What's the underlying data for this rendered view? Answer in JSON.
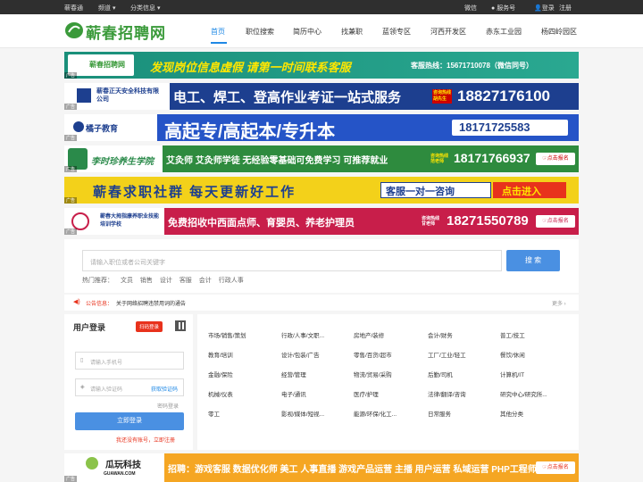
{
  "topbar": {
    "site": "蕲春通",
    "channel": "频道",
    "category": "分类信息",
    "wechat": "微信",
    "service": "服务号",
    "login": "登录",
    "register": "注册"
  },
  "header": {
    "logo_text": "蕲春招聘网",
    "nav": [
      "首页",
      "职位搜索",
      "简历中心",
      "找兼职",
      "蓝领专区",
      "河西开发区",
      "赤东工业园",
      "杨四岭园区"
    ]
  },
  "banners": {
    "b1": {
      "logo": "蕲春招聘网",
      "slogan": "发现岗位信息虚假  请第一时间联系客服",
      "hotline": "客服热线：15671710078（微信同号）"
    },
    "b2": {
      "company": "蕲春正天安全科技有限公司",
      "slogan": "电工、焊工、登高作业考证一站式服务",
      "contact": "咨询热线 胡先生",
      "phone": "18827176100"
    },
    "b3": {
      "company": "橘子教育",
      "slogan": "高起专/高起本/专升本",
      "phone": "18171725583"
    },
    "b4": {
      "company": "李时珍养生学院",
      "slogan": "艾灸师 艾灸师学徒 无经验零基础可免费学习 可推荐就业",
      "contact": "咨询热线 范老师",
      "phone": "18171766937",
      "btn": "点击报名"
    },
    "b5": {
      "slogan": "蕲春求职社群  每天更新好工作",
      "consult": "客服一对一咨询",
      "btn": "点击进入"
    },
    "b6": {
      "company": "蕲春大拇指康养职业技能培训学校",
      "slogan": "免费招收中西面点师、育婴员、养老护理员",
      "contact": "咨询热线 甘老师",
      "phone": "18271550789",
      "btn": "点击报名"
    },
    "b7": {
      "company": "瓜玩科技",
      "domain": "GUAWAN.COM",
      "slogan": "招聘：游戏客服 数据优化师 美工 人事直播 游戏产品运营 主播 用户运营 私域运营 PHP工程师",
      "btn": "点击报名"
    },
    "adtag": "广告"
  },
  "search": {
    "placeholder": "请输入职位或者公司关键字",
    "button": "搜 索",
    "hot_label": "热门推荐：",
    "hot": [
      "文员",
      "销售",
      "设计",
      "客服",
      "会计",
      "行政人事"
    ]
  },
  "notice": {
    "label": "公告信息：",
    "text": "关于网络招聘违禁用词的通告",
    "more": "更多 ›"
  },
  "login": {
    "title": "用户登录",
    "switch": "扫码登录",
    "phone_placeholder": "请输入手机号",
    "code_placeholder": "请输入验证码",
    "get_code": "获取验证码",
    "password_login": "密码登录",
    "submit": "立即登录",
    "no_account": "我还没有账号，立即注册"
  },
  "categories": [
    [
      "市场/销售/策划",
      "行政/人事/文职...",
      "房地产/装修",
      "会计/财务",
      "普工/技工"
    ],
    [
      "教育/培训",
      "设计/包装/广告",
      "零售/百货/超市",
      "工厂/工业/轻工",
      "餐饮/休闲"
    ],
    [
      "金融/保险",
      "经营/管理",
      "物流/贸易/采购",
      "后勤/司机",
      "计算机/IT"
    ],
    [
      "机械/仪表",
      "电子/通讯",
      "医疗/护理",
      "法律/翻译/咨询",
      "研究中心/研究所..."
    ],
    [
      "零工",
      "影视/媒体/短视...",
      "能源/环保/化工...",
      "日常服务",
      "其他分类"
    ]
  ]
}
